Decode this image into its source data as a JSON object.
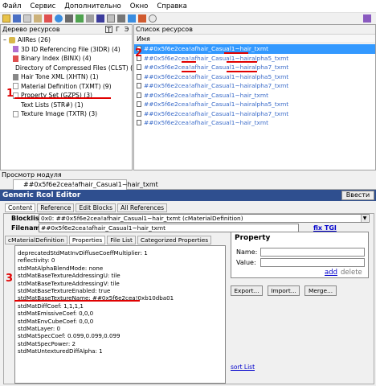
{
  "menu": [
    "Файл",
    "Сервис",
    "Дополнительно",
    "Окно",
    "Справка"
  ],
  "left_pane": {
    "title": "Дерево ресурсов",
    "view_buttons": [
      "T",
      "Г",
      "Э"
    ],
    "root": "AllRes (26)",
    "items": [
      "3D ID Referencing File (3IDR) (4)",
      "Binary Index (BINX) (4)",
      "Directory of Compressed Files (CLST) (1)",
      "Hair Tone XML (XHTN) (1)",
      "Material Definition (TXMT) (9)",
      "Property Set (GZPS) (3)",
      "Text Lists (STR#) (1)",
      "Texture Image (TXTR) (3)"
    ]
  },
  "right_pane": {
    "title": "Список ресурсов",
    "column": "Имя",
    "files": [
      "##0x5f6e2cea!afhair_Casual1~hair_txmt",
      "##0x5f6e2cea!afhair_Casual1~hairalpha5_txmt",
      "##0x5f6e2cea!afhair_Casual1~hairalpha7_txmt",
      "##0x5f6e2cea!afhair_Casual1~hairalpha5_txmt",
      "##0x5f6e2cea!afhair_Casual1~hairalpha7_txmt",
      "##0x5f6e2cea!afhair_Casual1~hair_txmt",
      "##0x5f6e2cea!afhair_Casual1~hairalpha5_txmt",
      "##0x5f6e2cea!afhair_Casual1~hairalpha7_txmt",
      "##0x5f6e2cea!afhair_Casual1~hair_txmt"
    ]
  },
  "preview": {
    "title": "Просмотр модуля",
    "tab": "##0x5f6e2cea!afhair_Casual1~hair_txmt"
  },
  "editor": {
    "title": "Generic Rcol Editor",
    "commit": "Ввести",
    "tabs": [
      "Content",
      "Reference",
      "Edit Blocks",
      "All References"
    ],
    "blocklist_label": "Blocklis",
    "blocklist_value": "0x0: ##0x5f6e2cea!afhair_Casual1~hair_txmt (cMaterialDefinition)",
    "filename_label": "Filenam",
    "filename_value": "##0x5f6e2cea!afhair_Casual1~hair_txmt",
    "fix_tgi": "fix TGI",
    "subtabs": [
      "cMaterialDefinition",
      "Properties",
      "File List",
      "Categorized Properties"
    ],
    "properties": [
      "deprecatedStdMatInvDiffuseCoeffMultiplier: 1",
      "reflectivity: 0",
      "stdMatAlphaBlendMode: none",
      "stdMatBaseTextureAddressingU: tile",
      "stdMatBaseTextureAddressingV: tile",
      "stdMatBaseTextureEnabled: true",
      "stdMatBaseTextureName: ##0x5f6e2cea!0xb10dba01",
      "stdMatDiffCoef: 1,1,1,1",
      "stdMatEmissiveCoef: 0,0,0",
      "stdMatEnvCubeCoef: 0,0,0",
      "stdMatLayer: 0",
      "stdMatSpecCoef: 0.099,0.099,0.099",
      "stdMatSpecPower: 2",
      "stdMatUntexturedDiffAlpha: 1"
    ],
    "property_panel": {
      "title": "Property",
      "name_label": "Name:",
      "value_label": "Value:",
      "add": "add",
      "delete": "delete"
    },
    "buttons": [
      "Export...",
      "Import...",
      "Merge..."
    ],
    "sort_list": "sort List"
  },
  "annotations": [
    "1",
    "2",
    "3"
  ],
  "colors": {
    "title_bar": "#2f4f8f",
    "selection": "#3399ff",
    "marker": "#e00000",
    "link": "#3a6bc9"
  }
}
